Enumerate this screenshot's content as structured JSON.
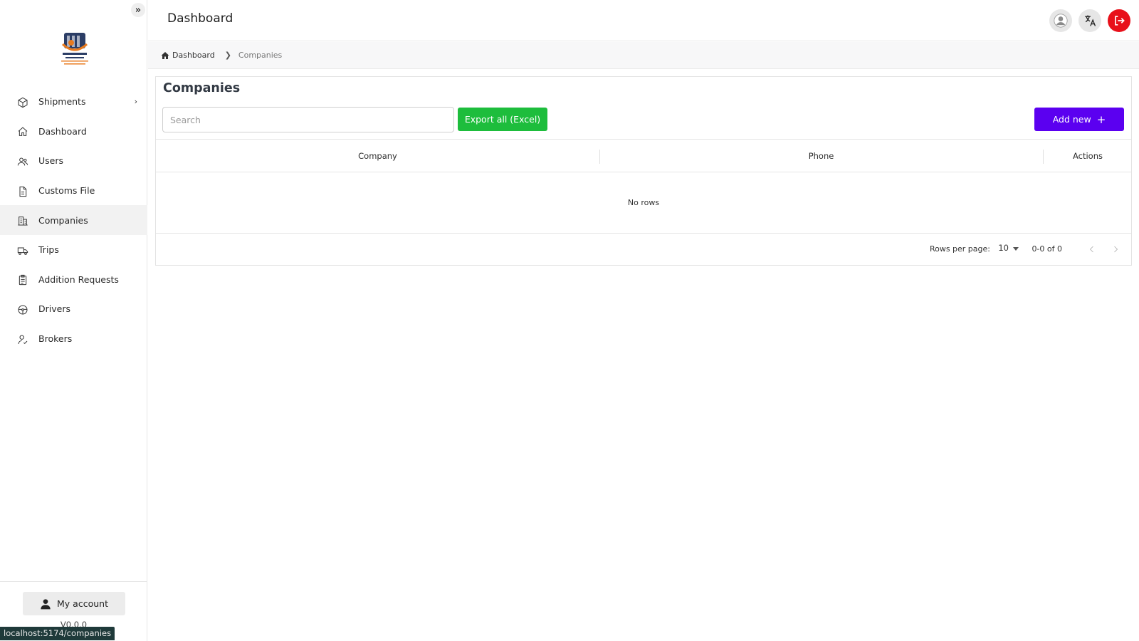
{
  "app": {
    "page_title": "Dashboard",
    "status_url": "localhost:5174/companies",
    "version": "V0.0.0",
    "colors": {
      "accent": "#5b00f0",
      "export_green": "#1dbd3c",
      "logout_red": "#e8101a"
    }
  },
  "sidebar": {
    "collapse_icon": "double-chevron-right-icon",
    "items": [
      {
        "label": "Shipments",
        "icon": "box-icon",
        "has_submenu": true
      },
      {
        "label": "Dashboard",
        "icon": "home-icon"
      },
      {
        "label": "Users",
        "icon": "users-icon"
      },
      {
        "label": "Customs File",
        "icon": "file-icon"
      },
      {
        "label": "Companies",
        "icon": "building-icon",
        "active": true
      },
      {
        "label": "Trips",
        "icon": "truck-icon"
      },
      {
        "label": "Addition Requests",
        "icon": "clipboard-icon"
      },
      {
        "label": "Drivers",
        "icon": "steering-wheel-icon"
      },
      {
        "label": "Brokers",
        "icon": "user-check-icon"
      }
    ],
    "account_label": "My account"
  },
  "breadcrumb": {
    "home": "Dashboard",
    "current": "Companies"
  },
  "companies": {
    "title": "Companies",
    "search_placeholder": "Search",
    "export_label": "Export all (Excel)",
    "add_label": "Add new",
    "columns": [
      "Company",
      "Phone",
      "Actions"
    ],
    "rows": [],
    "empty_text": "No rows",
    "pagination": {
      "rows_per_page_label": "Rows per page:",
      "rows_per_page": "10",
      "range": "0-0 of 0"
    }
  }
}
